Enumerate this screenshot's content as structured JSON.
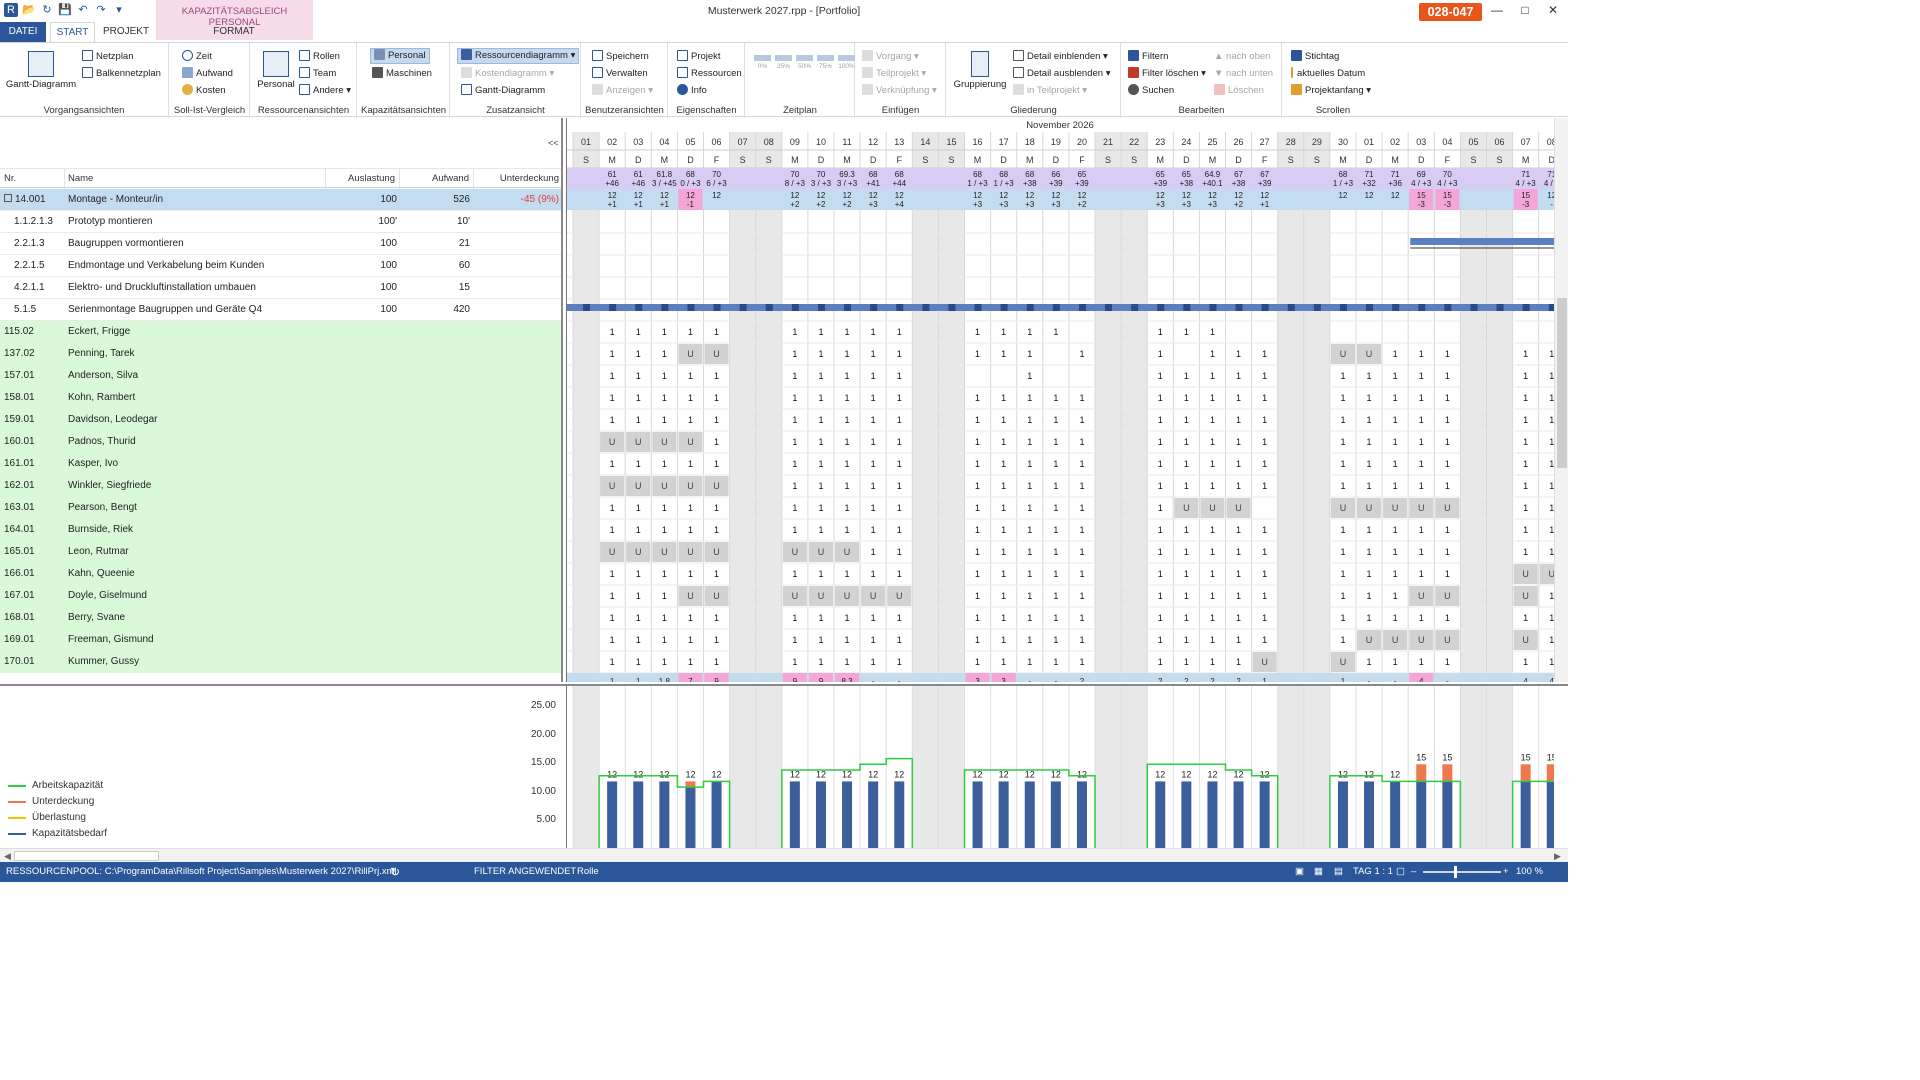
{
  "window": {
    "title": "Musterwerk 2027.rpp - [Portfolio]",
    "context_tab": "KAPAZITÄTSABGLEICH PERSONAL",
    "badge": "028-047"
  },
  "tabs": {
    "datei": "DATEI",
    "start": "START",
    "projekt": "PROJEKT",
    "format": "FORMAT"
  },
  "ribbon": {
    "vorgangsansichten": {
      "label": "Vorgangsansichten",
      "gantt": "Gantt-Diagramm",
      "netzplan": "Netzplan",
      "balkennetzplan": "Balkennetzplan"
    },
    "sollist": {
      "label": "Soll-Ist-Vergleich",
      "zeit": "Zeit",
      "aufwand": "Aufwand",
      "kosten": "Kosten"
    },
    "ressourcenansichten": {
      "label": "Ressourcenansichten",
      "personal": "Personal",
      "rollen": "Rollen",
      "team": "Team",
      "andere": "Andere"
    },
    "kapazitaet": {
      "label": "Kapazitätsansichten",
      "personal": "Personal",
      "maschinen": "Maschinen"
    },
    "zusatz": {
      "label": "Zusatzansicht",
      "ressourcendiagramm": "Ressourcendiagramm",
      "kostendiagramm": "Kostendiagramm",
      "gantt": "Gantt-Diagramm"
    },
    "benutzer": {
      "label": "Benutzeransichten",
      "speichern": "Speichern",
      "verwalten": "Verwalten",
      "anzeigen": "Anzeigen"
    },
    "eigenschaften": {
      "label": "Eigenschaften",
      "projekt": "Projekt",
      "ressourcen": "Ressourcen",
      "info": "Info"
    },
    "zeitplan": {
      "label": "Zeitplan",
      "steps": [
        "0%",
        "25%",
        "50%",
        "75%",
        "100%"
      ]
    },
    "einfuegen": {
      "label": "Einfügen",
      "vorgang": "Vorgang",
      "teilprojekt": "Teilprojekt",
      "verknuepfung": "Verknüpfung"
    },
    "gliederung": {
      "label": "Gliederung",
      "gruppierung": "Gruppierung",
      "einblenden": "Detail einblenden",
      "ausblenden": "Detail ausblenden",
      "teilprojekt": "in Teilprojekt"
    },
    "bearbeiten": {
      "label": "Bearbeiten",
      "filtern": "Filtern",
      "filter_loeschen": "Filter löschen",
      "suchen": "Suchen",
      "nach_oben": "nach oben",
      "nach_unten": "nach unten",
      "loeschen": "Löschen"
    },
    "scrollen": {
      "label": "Scrollen",
      "stichtag": "Stichtag",
      "aktuelles_datum": "aktuelles Datum",
      "projektanfang": "Projektanfang"
    }
  },
  "grid": {
    "collapse": "<<",
    "columns": {
      "nr": "Nr.",
      "name": "Name",
      "auslastung": "Auslastung",
      "aufwand": "Aufwand",
      "unterdeckung": "Unterdeckung"
    },
    "rows": [
      {
        "nr": "14.001",
        "name": "Montage - Monteur/in",
        "auslastung": "100",
        "aufwand": "526",
        "unterdeckung": "-45 (9%)",
        "kind": "summary"
      },
      {
        "nr": "1.1.2.1.3",
        "name": "Prototyp montieren",
        "auslastung": "100'",
        "aufwand": "10'",
        "unterdeckung": "",
        "kind": "task"
      },
      {
        "nr": "2.2.1.3",
        "name": "Baugruppen vormontieren",
        "auslastung": "100",
        "aufwand": "21",
        "unterdeckung": "",
        "kind": "task"
      },
      {
        "nr": "2.2.1.5",
        "name": "Endmontage und Verkabelung beim Kunden",
        "auslastung": "100",
        "aufwand": "60",
        "unterdeckung": "",
        "kind": "task"
      },
      {
        "nr": "4.2.1.1",
        "name": "Elektro- und Druckluftinstallation umbauen",
        "auslastung": "100",
        "aufwand": "15",
        "unterdeckung": "",
        "kind": "task"
      },
      {
        "nr": "5.1.5",
        "name": "Serienmontage Baugruppen und Geräte Q4",
        "auslastung": "100",
        "aufwand": "420",
        "unterdeckung": "",
        "kind": "task"
      },
      {
        "nr": "115.02",
        "name": "Eckert, Frigge",
        "kind": "resource"
      },
      {
        "nr": "137.02",
        "name": "Penning, Tarek",
        "kind": "resource"
      },
      {
        "nr": "157.01",
        "name": "Anderson, Silva",
        "kind": "resource"
      },
      {
        "nr": "158.01",
        "name": "Kohn, Rambert",
        "kind": "resource"
      },
      {
        "nr": "159.01",
        "name": "Davidson, Leodegar",
        "kind": "resource"
      },
      {
        "nr": "160.01",
        "name": "Padnos, Thurid",
        "kind": "resource"
      },
      {
        "nr": "161.01",
        "name": "Kasper, Ivo",
        "kind": "resource"
      },
      {
        "nr": "162.01",
        "name": "Winkler, Siegfriede",
        "kind": "resource"
      },
      {
        "nr": "163.01",
        "name": "Pearson, Bengt",
        "kind": "resource"
      },
      {
        "nr": "164.01",
        "name": "Burnside, Riek",
        "kind": "resource"
      },
      {
        "nr": "165.01",
        "name": "Leon, Rutmar",
        "kind": "resource"
      },
      {
        "nr": "166.01",
        "name": "Kahn, Queenie",
        "kind": "resource"
      },
      {
        "nr": "167.01",
        "name": "Doyle, Giselmund",
        "kind": "resource"
      },
      {
        "nr": "168.01",
        "name": "Berry, Svane",
        "kind": "resource"
      },
      {
        "nr": "169.01",
        "name": "Freeman, Gismund",
        "kind": "resource"
      },
      {
        "nr": "170.01",
        "name": "Kummer, Gussy",
        "kind": "resource"
      }
    ]
  },
  "timeline": {
    "month": "November 2026",
    "days": [
      {
        "d": "01",
        "w": "S",
        "we": true
      },
      {
        "d": "02",
        "w": "M"
      },
      {
        "d": "03",
        "w": "D"
      },
      {
        "d": "04",
        "w": "M"
      },
      {
        "d": "05",
        "w": "D"
      },
      {
        "d": "06",
        "w": "F"
      },
      {
        "d": "07",
        "w": "S",
        "we": true
      },
      {
        "d": "08",
        "w": "S",
        "we": true
      },
      {
        "d": "09",
        "w": "M"
      },
      {
        "d": "10",
        "w": "D"
      },
      {
        "d": "11",
        "w": "M"
      },
      {
        "d": "12",
        "w": "D"
      },
      {
        "d": "13",
        "w": "F"
      },
      {
        "d": "14",
        "w": "S",
        "we": true
      },
      {
        "d": "15",
        "w": "S",
        "we": true
      },
      {
        "d": "16",
        "w": "M"
      },
      {
        "d": "17",
        "w": "D"
      },
      {
        "d": "18",
        "w": "M"
      },
      {
        "d": "19",
        "w": "D"
      },
      {
        "d": "20",
        "w": "F"
      },
      {
        "d": "21",
        "w": "S",
        "we": true
      },
      {
        "d": "22",
        "w": "S",
        "we": true
      },
      {
        "d": "23",
        "w": "M"
      },
      {
        "d": "24",
        "w": "D"
      },
      {
        "d": "25",
        "w": "M"
      },
      {
        "d": "26",
        "w": "D"
      },
      {
        "d": "27",
        "w": "F"
      },
      {
        "d": "28",
        "w": "S",
        "we": true
      },
      {
        "d": "29",
        "w": "S",
        "we": true
      },
      {
        "d": "30",
        "w": "M"
      },
      {
        "d": "01",
        "w": "D"
      },
      {
        "d": "02",
        "w": "M"
      },
      {
        "d": "03",
        "w": "D"
      },
      {
        "d": "04",
        "w": "F"
      },
      {
        "d": "05",
        "w": "S",
        "we": true
      },
      {
        "d": "06",
        "w": "S",
        "we": true
      },
      {
        "d": "07",
        "w": "M"
      },
      {
        "d": "08",
        "w": "D"
      }
    ],
    "capacity_row": [
      [
        "",
        ""
      ],
      [
        "61",
        "+46"
      ],
      [
        "61",
        "+46"
      ],
      [
        "61.8",
        "3 / +45"
      ],
      [
        "68",
        "0 / +3"
      ],
      [
        "70",
        "6 / +3"
      ],
      [
        "",
        ""
      ],
      [
        "",
        ""
      ],
      [
        "70",
        "8 / +3"
      ],
      [
        "70",
        "3 / +3"
      ],
      [
        "69.3",
        "3 / +3"
      ],
      [
        "68",
        "+41"
      ],
      [
        "68",
        "+44"
      ],
      [
        "",
        ""
      ],
      [
        "",
        ""
      ],
      [
        "68",
        "1 / +3"
      ],
      [
        "68",
        "1 / +3"
      ],
      [
        "68",
        "+38"
      ],
      [
        "66",
        "+39"
      ],
      [
        "65",
        "+39"
      ],
      [
        "",
        ""
      ],
      [
        "",
        ""
      ],
      [
        "65",
        "+39"
      ],
      [
        "65",
        "+38"
      ],
      [
        "64.9",
        "+40.1"
      ],
      [
        "67",
        "+38"
      ],
      [
        "67",
        "+39"
      ],
      [
        "",
        ""
      ],
      [
        "",
        ""
      ],
      [
        "68",
        "1 / +3"
      ],
      [
        "71",
        "+32"
      ],
      [
        "71",
        "+36"
      ],
      [
        "69",
        "4 / +3"
      ],
      [
        "70",
        "4 / +3"
      ],
      [
        "",
        ""
      ],
      [
        "",
        ""
      ],
      [
        "71",
        "4 / +3"
      ],
      [
        "71",
        "4 / +"
      ]
    ],
    "summary_row": [
      [
        "",
        ""
      ],
      [
        "12",
        "+1"
      ],
      [
        "12",
        "+1"
      ],
      [
        "12",
        "+1"
      ],
      [
        "12",
        "-1",
        "pink"
      ],
      [
        "12",
        ""
      ],
      [
        "",
        ""
      ],
      [
        "",
        ""
      ],
      [
        "12",
        "+2"
      ],
      [
        "12",
        "+2"
      ],
      [
        "12",
        "+2"
      ],
      [
        "12",
        "+3"
      ],
      [
        "12",
        "+4"
      ],
      [
        "",
        ""
      ],
      [
        "",
        ""
      ],
      [
        "12",
        "+3"
      ],
      [
        "12",
        "+3"
      ],
      [
        "12",
        "+3"
      ],
      [
        "12",
        "+3"
      ],
      [
        "12",
        "+2"
      ],
      [
        "",
        ""
      ],
      [
        "",
        ""
      ],
      [
        "12",
        "+3"
      ],
      [
        "12",
        "+3"
      ],
      [
        "12",
        "+3"
      ],
      [
        "12",
        "+2"
      ],
      [
        "12",
        "+1"
      ],
      [
        "",
        ""
      ],
      [
        "",
        ""
      ],
      [
        "12",
        ""
      ],
      [
        "12",
        ""
      ],
      [
        "12",
        ""
      ],
      [
        "15",
        "-3",
        "pink"
      ],
      [
        "15",
        "-3",
        "pink"
      ],
      [
        "",
        ""
      ],
      [
        "",
        ""
      ],
      [
        "15",
        "-3",
        "pink"
      ],
      [
        "12",
        "-"
      ]
    ],
    "resources": [
      "_11111__11111__1111___111_______________",
      "_111UU__11111__111_1__1_111__UU111__11",
      "_11111__11111____1____11111__11111__11",
      "_11111__11111__11111__11111__11111__11",
      "_11111__11111__11111__11111__11111__11",
      "_UUUU1__11111__11111__11111__11111__11",
      "_11111__11111__11111__11111__11111__11",
      "_UUUUU__11111__11111__11111__11111__11",
      "_11111__11111__11111__1UUU___UUUUU__11",
      "_11111__11111__11111__11111__11111__11",
      "_UUUUU__UUU11__11111__11111__11111__11",
      "_11111__11111__11111__11111__11111__UU",
      "_111UU__UUUUU__11111__11111__111UU__U1",
      "_11111__11111__11111__11111__11111__11",
      "_11111__11111__11111__11111__1UUUU__U1",
      "_11111__11111__11111__1111U__U1111__11"
    ],
    "partial_row": [
      [
        "",
        ""
      ],
      [
        "1",
        ""
      ],
      [
        "1",
        ""
      ],
      [
        "1.8",
        ""
      ],
      [
        "7",
        "pink"
      ],
      [
        "9",
        "pink"
      ],
      [
        "",
        ""
      ],
      [
        "",
        ""
      ],
      [
        "9",
        "pink"
      ],
      [
        "9",
        "pink"
      ],
      [
        "8.3",
        "pink"
      ],
      [
        "-",
        ""
      ],
      [
        "-",
        ""
      ],
      [
        "",
        ""
      ],
      [
        "",
        ""
      ],
      [
        "3",
        "pink"
      ],
      [
        "3",
        "pink"
      ],
      [
        "-",
        ""
      ],
      [
        "-",
        ""
      ],
      [
        "2",
        ""
      ],
      [
        "",
        ""
      ],
      [
        "",
        ""
      ],
      [
        "2",
        ""
      ],
      [
        "2",
        ""
      ],
      [
        "2",
        ""
      ],
      [
        "2",
        ""
      ],
      [
        "1",
        ""
      ],
      [
        "",
        ""
      ],
      [
        "",
        ""
      ],
      [
        "1",
        ""
      ],
      [
        "-",
        ""
      ],
      [
        "-",
        ""
      ],
      [
        "4",
        "pink"
      ],
      [
        "-",
        ""
      ],
      [
        "",
        ""
      ],
      [
        "",
        ""
      ],
      [
        "4",
        ""
      ],
      [
        "4",
        ""
      ]
    ]
  },
  "chart_data": {
    "type": "bar",
    "title": "",
    "xlabel": "",
    "ylabel": "",
    "ylim": [
      0,
      28
    ],
    "yticks": [
      "25.00",
      "20.00",
      "15.00",
      "10.00",
      "5.00"
    ],
    "categories": [
      "01",
      "02",
      "03",
      "04",
      "05",
      "06",
      "07",
      "08",
      "09",
      "10",
      "11",
      "12",
      "13",
      "14",
      "15",
      "16",
      "17",
      "18",
      "19",
      "20",
      "21",
      "22",
      "23",
      "24",
      "25",
      "26",
      "27",
      "28",
      "29",
      "30",
      "01",
      "02",
      "03",
      "04",
      "05",
      "06",
      "07",
      "08"
    ],
    "series": [
      {
        "name": "Kapazitätsbedarf",
        "values": [
          0,
          12,
          12,
          12,
          11,
          12,
          0,
          0,
          12,
          12,
          12,
          12,
          12,
          0,
          0,
          12,
          12,
          12,
          12,
          12,
          0,
          0,
          12,
          12,
          12,
          12,
          12,
          0,
          0,
          12,
          12,
          12,
          12,
          12,
          0,
          0,
          12,
          12
        ]
      },
      {
        "name": "Unterdeckung",
        "values": [
          0,
          0,
          0,
          0,
          1,
          0,
          0,
          0,
          0,
          0,
          0,
          0,
          0,
          0,
          0,
          0,
          0,
          0,
          0,
          0,
          0,
          0,
          0,
          0,
          0,
          0,
          0,
          0,
          0,
          0,
          0,
          0,
          3,
          3,
          0,
          0,
          3,
          3
        ]
      },
      {
        "name": "Arbeitskapazität",
        "values": [
          0,
          13,
          13,
          13,
          11,
          12,
          0,
          0,
          14,
          14,
          14,
          15,
          16,
          0,
          0,
          14,
          14,
          14,
          14,
          13,
          0,
          0,
          15,
          15,
          15,
          14,
          13,
          0,
          0,
          13,
          13,
          12,
          12,
          12,
          0,
          0,
          12,
          12
        ]
      },
      {
        "name": "Überlastung",
        "values": [
          0,
          0,
          0,
          0,
          0,
          0,
          0,
          0,
          0,
          0,
          0,
          0,
          0,
          0,
          0,
          0,
          0,
          0,
          0,
          0,
          0,
          0,
          0,
          0,
          0,
          0,
          0,
          0,
          0,
          0,
          0,
          0,
          0,
          0,
          0,
          0,
          0,
          0
        ]
      }
    ],
    "bar_labels": [
      "",
      "12",
      "12",
      "12",
      "12",
      "12",
      "",
      "",
      "12",
      "12",
      "12",
      "12",
      "12",
      "",
      "",
      "12",
      "12",
      "12",
      "12",
      "12",
      "",
      "",
      "12",
      "12",
      "12",
      "12",
      "12",
      "",
      "",
      "12",
      "12",
      "12",
      "15",
      "15",
      "",
      "",
      "15",
      "15"
    ],
    "colors": {
      "Kapazitätsbedarf": "#3b5f9c",
      "Unterdeckung": "#f07850",
      "Arbeitskapazität": "#2ecc40",
      "Überlastung": "#f2c200"
    }
  },
  "legend": [
    {
      "label": "Arbeitskapazität",
      "color": "#2ecc40"
    },
    {
      "label": "Unterdeckung",
      "color": "#f07850"
    },
    {
      "label": "Überlastung",
      "color": "#f2c200"
    },
    {
      "label": "Kapazitätsbedarf",
      "color": "#3b5f9c"
    }
  ],
  "status": {
    "pool": "RESSOURCENPOOL: C:\\ProgramData\\Rillsoft Project\\Samples\\Musterwerk 2027\\RillPrj.xml",
    "filter": "FILTER ANGEWENDET",
    "rolle": "Rolle",
    "tag": "TAG 1 : 1",
    "zoom": "100 %"
  }
}
